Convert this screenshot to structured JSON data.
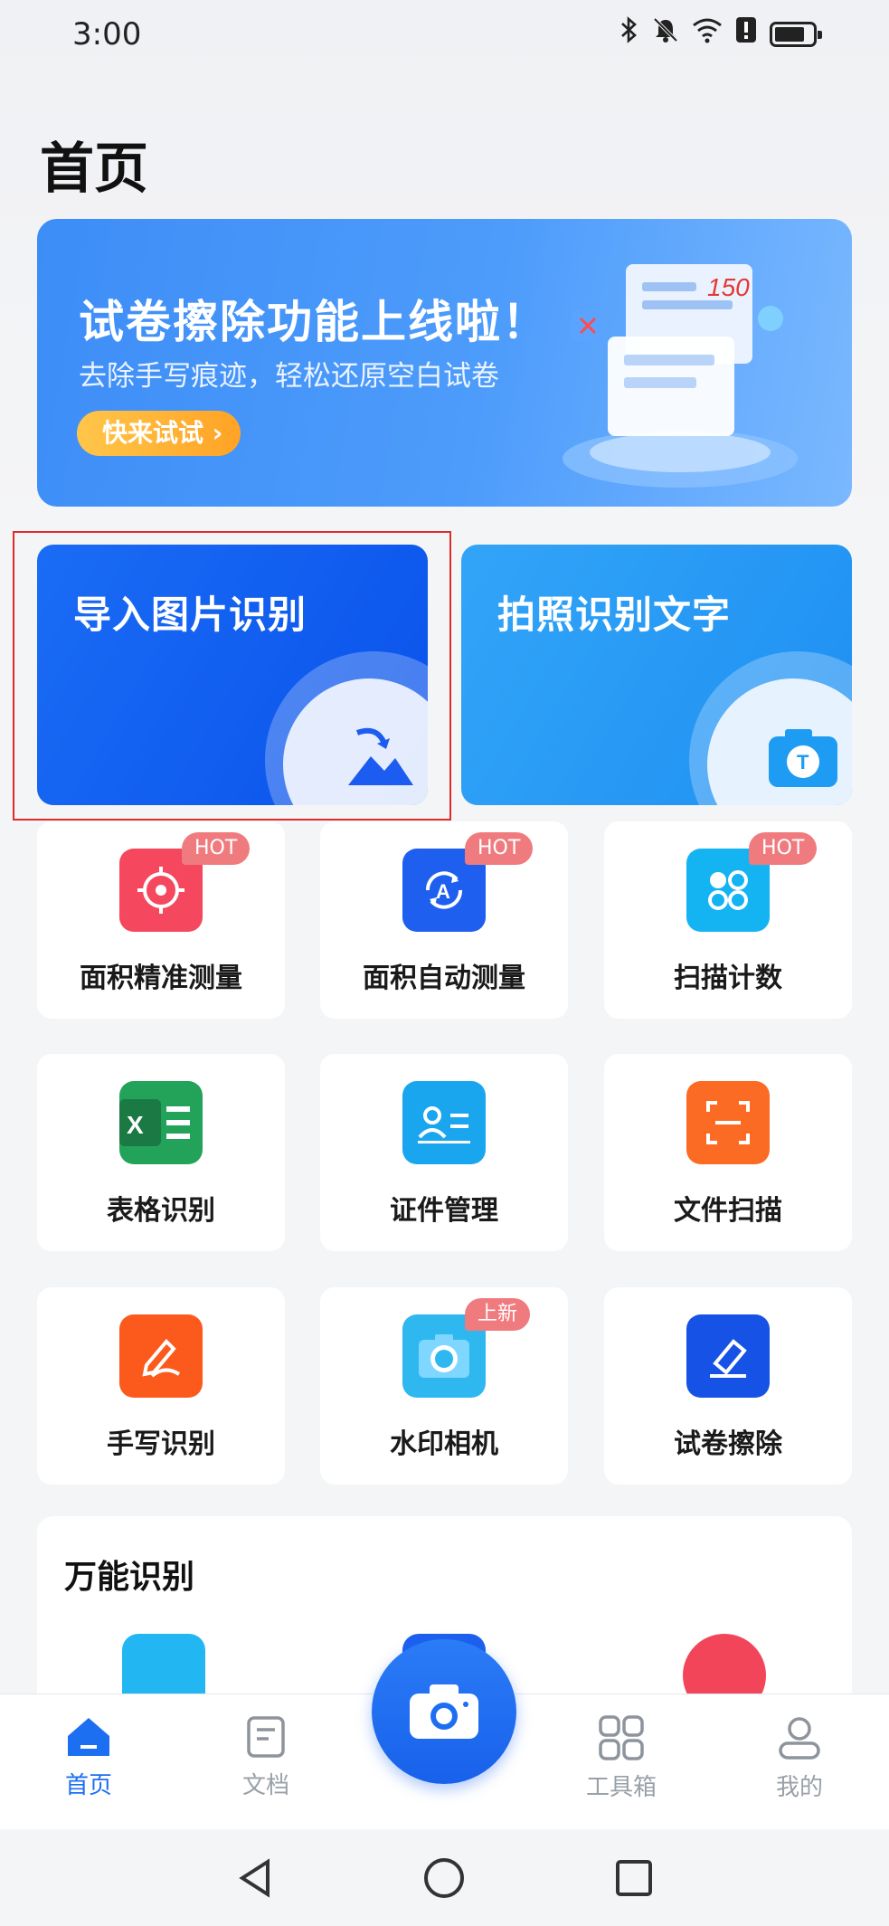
{
  "status_bar": {
    "time": "3:00",
    "icons": [
      "bluetooth-icon",
      "bell-muted-icon",
      "wifi-icon",
      "alert-icon",
      "battery-icon"
    ]
  },
  "page": {
    "title": "首页"
  },
  "banner": {
    "title": "试卷擦除功能上线啦！",
    "subtitle": "去除手写痕迹，轻松还原空白试卷",
    "cta": "快来试试",
    "score_text": "150"
  },
  "features": {
    "import": {
      "label": "导入图片识别",
      "color": "#0a52eb"
    },
    "photo": {
      "label": "拍照识别文字",
      "color": "#1e8ff2"
    }
  },
  "tools": [
    {
      "label": "面积精准测量",
      "badge": "HOT",
      "icon": "target-icon",
      "color": "#f5475d"
    },
    {
      "label": "面积自动测量",
      "badge": "HOT",
      "icon": "auto-measure-icon",
      "color": "#1f5ff0"
    },
    {
      "label": "扫描计数",
      "badge": "HOT",
      "icon": "count-dots-icon",
      "color": "#14b4f2"
    },
    {
      "label": "表格识别",
      "badge": "",
      "icon": "excel-icon",
      "color": "#23a35a"
    },
    {
      "label": "证件管理",
      "badge": "",
      "icon": "id-card-icon",
      "color": "#1aa6ee"
    },
    {
      "label": "文件扫描",
      "badge": "",
      "icon": "scan-doc-icon",
      "color": "#fb6b24"
    },
    {
      "label": "手写识别",
      "badge": "",
      "icon": "handwriting-icon",
      "color": "#fb5a1c"
    },
    {
      "label": "水印相机",
      "badge": "上新",
      "icon": "watermark-camera-icon",
      "color": "#2fb8ef"
    },
    {
      "label": "试卷擦除",
      "badge": "",
      "icon": "eraser-icon",
      "color": "#1652e6"
    }
  ],
  "universal": {
    "title": "万能识别"
  },
  "bottom_nav": {
    "items": [
      {
        "label": "首页",
        "icon": "home-icon",
        "active": true
      },
      {
        "label": "文档",
        "icon": "document-icon",
        "active": false
      },
      {
        "label": "工具箱",
        "icon": "toolbox-icon",
        "active": false
      },
      {
        "label": "我的",
        "icon": "profile-icon",
        "active": false
      }
    ],
    "fab_icon": "camera-icon"
  },
  "colors": {
    "accent": "#1d6ff2",
    "inactive": "#9aa0a8"
  }
}
